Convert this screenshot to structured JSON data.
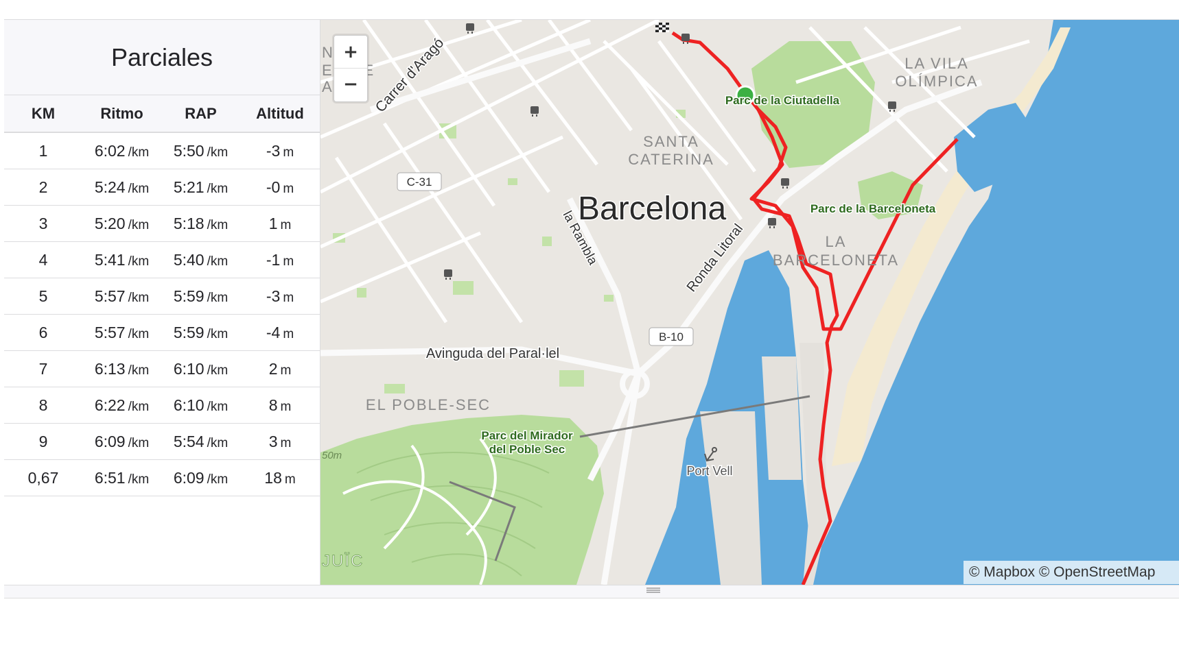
{
  "splits": {
    "title": "Parciales",
    "columns": [
      "KM",
      "Ritmo",
      "RAP",
      "Altitud"
    ],
    "rows": [
      {
        "km": "1",
        "pace": "6:02",
        "pace_unit": "/km",
        "gap": "5:50",
        "gap_unit": "/km",
        "elev": "-3",
        "elev_unit": "m"
      },
      {
        "km": "2",
        "pace": "5:24",
        "pace_unit": "/km",
        "gap": "5:21",
        "gap_unit": "/km",
        "elev": "-0",
        "elev_unit": "m"
      },
      {
        "km": "3",
        "pace": "5:20",
        "pace_unit": "/km",
        "gap": "5:18",
        "gap_unit": "/km",
        "elev": "1",
        "elev_unit": "m"
      },
      {
        "km": "4",
        "pace": "5:41",
        "pace_unit": "/km",
        "gap": "5:40",
        "gap_unit": "/km",
        "elev": "-1",
        "elev_unit": "m"
      },
      {
        "km": "5",
        "pace": "5:57",
        "pace_unit": "/km",
        "gap": "5:59",
        "gap_unit": "/km",
        "elev": "-3",
        "elev_unit": "m"
      },
      {
        "km": "6",
        "pace": "5:57",
        "pace_unit": "/km",
        "gap": "5:59",
        "gap_unit": "/km",
        "elev": "-4",
        "elev_unit": "m"
      },
      {
        "km": "7",
        "pace": "6:13",
        "pace_unit": "/km",
        "gap": "6:10",
        "gap_unit": "/km",
        "elev": "2",
        "elev_unit": "m"
      },
      {
        "km": "8",
        "pace": "6:22",
        "pace_unit": "/km",
        "gap": "6:10",
        "gap_unit": "/km",
        "elev": "8",
        "elev_unit": "m"
      },
      {
        "km": "9",
        "pace": "6:09",
        "pace_unit": "/km",
        "gap": "5:54",
        "gap_unit": "/km",
        "elev": "3",
        "elev_unit": "m"
      },
      {
        "km": "0,67",
        "pace": "6:51",
        "pace_unit": "/km",
        "gap": "6:09",
        "gap_unit": "/km",
        "elev": "18",
        "elev_unit": "m"
      }
    ]
  },
  "map": {
    "zoom_in_label": "+",
    "zoom_out_label": "−",
    "attribution": "© Mapbox © OpenStreetMap",
    "labels": {
      "city": "Barcelona",
      "santa_caterina_1": "SANTA",
      "santa_caterina_2": "CATERINA",
      "vila_olimpica_1": "LA VILA",
      "vila_olimpica_2": "OLÍMPICA",
      "barceloneta_1": "LA",
      "barceloneta_2": "BARCELONETA",
      "poble_sec": "EL POBLE-SEC",
      "eixample_1": "NT",
      "eixample_2": "ER DE",
      "eixample_3": "AN E",
      "carrer_arago": "Carrer d'Aragó",
      "la_rambla": "la Rambla",
      "ronda_litoral": "Ronda Litoral",
      "avinguda_parallel": "Avinguda del Paral·lel",
      "parc_ciutadella": "Parc de la Ciutadella",
      "parc_barceloneta": "Parc de la Barceloneta",
      "parc_mirador_1": "Parc del Mirador",
      "parc_mirador_2": "del Poble Sec",
      "port_vell": "Port Vell",
      "montjuic": "JUÏC",
      "contour_50m": "50m",
      "road_c31": "C-31",
      "road_b10": "B-10"
    },
    "colors": {
      "route": "#ee2222",
      "start_marker": "#3cb043",
      "water": "#5ea8dc",
      "park": "#b8dc9c",
      "land": "#eae7e2",
      "road": "#ffffff",
      "park_label": "#2e6a1e"
    },
    "icons": [
      "metro-station-icon",
      "finish-flag-icon",
      "anchor-icon"
    ]
  }
}
